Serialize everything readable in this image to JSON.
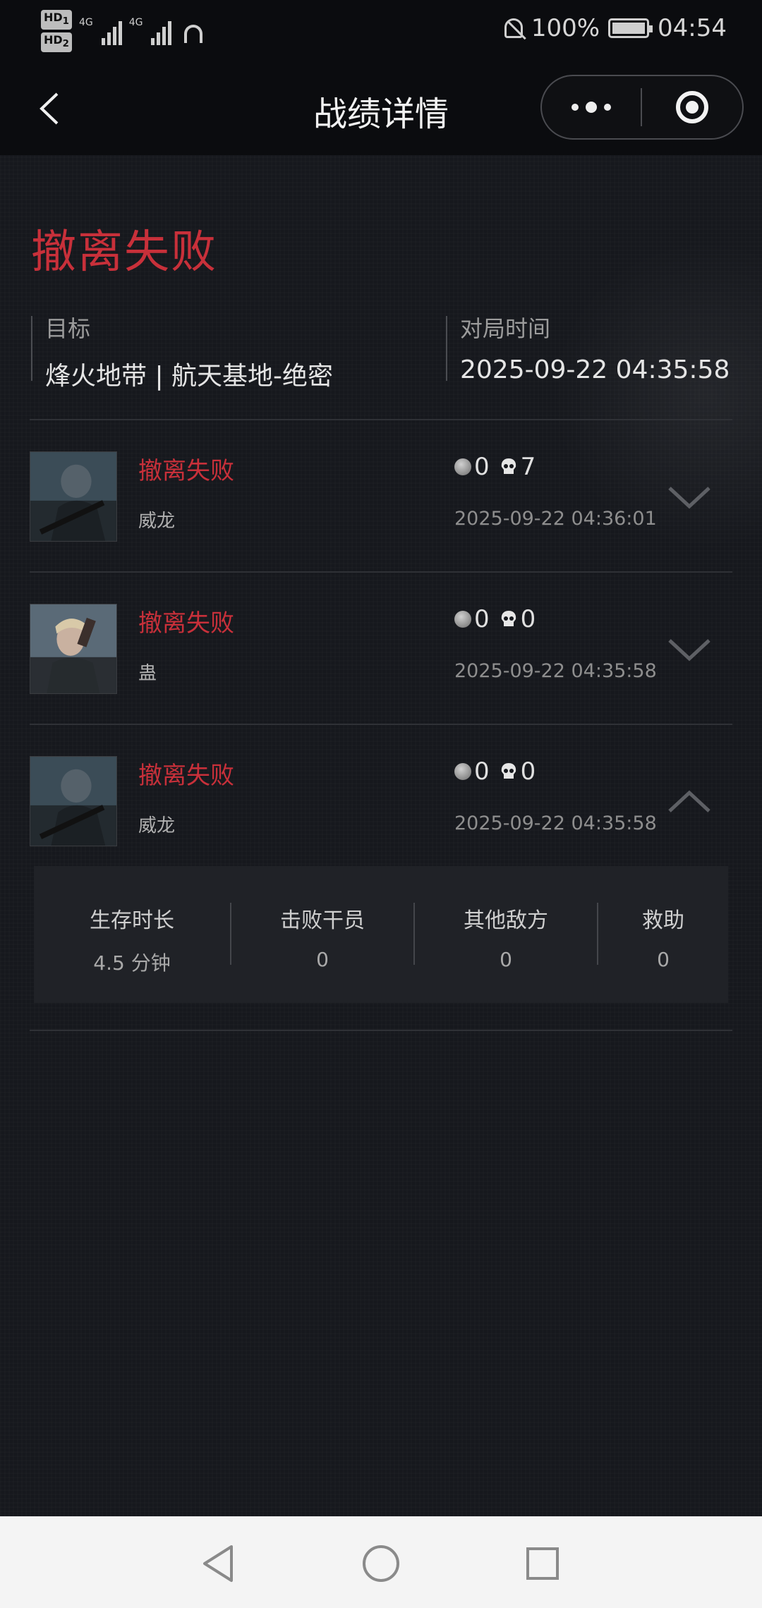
{
  "status_bar": {
    "hd1": "HD",
    "hd1_sub": "1",
    "hd2": "HD",
    "hd2_sub": "2",
    "net1": "4G",
    "net2": "4G",
    "battery_percent": "100%",
    "time": "04:54"
  },
  "nav": {
    "title": "战绩详情",
    "back_icon": "chevron-left-icon",
    "more_icon": "more-dots-icon",
    "close_icon": "target-close-icon"
  },
  "header": {
    "result": "撤离失败",
    "target_label": "目标",
    "target_value": "烽火地带 | 航天基地-绝密",
    "time_label": "对局时间",
    "time_value": "2025-09-22 04:35:58"
  },
  "colors": {
    "accent_red": "#c8303a",
    "background": "#16181d"
  },
  "records": [
    {
      "status": "撤离失败",
      "name": "威龙",
      "coin_count": "0",
      "kill_count": "7",
      "time": "2025-09-22 04:36:01",
      "expanded": false
    },
    {
      "status": "撤离失败",
      "name": "蛊",
      "coin_count": "0",
      "kill_count": "0",
      "time": "2025-09-22 04:35:58",
      "expanded": false
    },
    {
      "status": "撤离失败",
      "name": "威龙",
      "coin_count": "0",
      "kill_count": "0",
      "time": "2025-09-22 04:35:58",
      "expanded": true
    }
  ],
  "detail": {
    "survival_label": "生存时长",
    "survival_value": "4.5 分钟",
    "operators_label": "击败干员",
    "operators_value": "0",
    "other_label": "其他敌方",
    "other_value": "0",
    "assist_label": "救助",
    "assist_value": "0"
  },
  "system_nav": {
    "back_icon": "triangle-back-icon",
    "home_icon": "circle-home-icon",
    "recents_icon": "square-recents-icon"
  }
}
